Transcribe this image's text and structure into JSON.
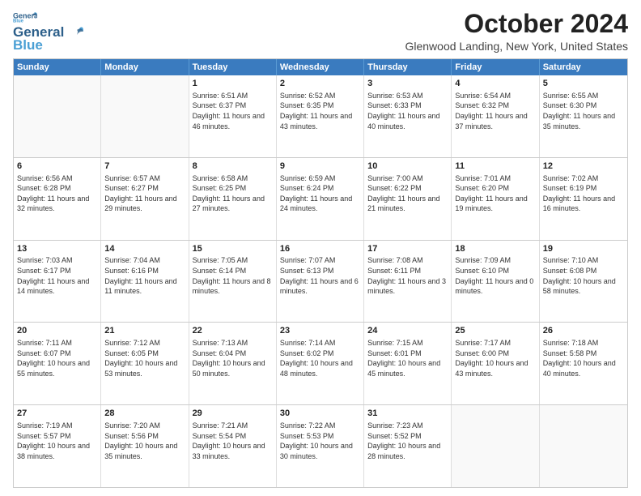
{
  "header": {
    "logo_line1": "General",
    "logo_line2": "Blue",
    "month_title": "October 2024",
    "location": "Glenwood Landing, New York, United States"
  },
  "days_of_week": [
    "Sunday",
    "Monday",
    "Tuesday",
    "Wednesday",
    "Thursday",
    "Friday",
    "Saturday"
  ],
  "weeks": [
    [
      {
        "day": "",
        "text": ""
      },
      {
        "day": "",
        "text": ""
      },
      {
        "day": "1",
        "text": "Sunrise: 6:51 AM\nSunset: 6:37 PM\nDaylight: 11 hours and 46 minutes."
      },
      {
        "day": "2",
        "text": "Sunrise: 6:52 AM\nSunset: 6:35 PM\nDaylight: 11 hours and 43 minutes."
      },
      {
        "day": "3",
        "text": "Sunrise: 6:53 AM\nSunset: 6:33 PM\nDaylight: 11 hours and 40 minutes."
      },
      {
        "day": "4",
        "text": "Sunrise: 6:54 AM\nSunset: 6:32 PM\nDaylight: 11 hours and 37 minutes."
      },
      {
        "day": "5",
        "text": "Sunrise: 6:55 AM\nSunset: 6:30 PM\nDaylight: 11 hours and 35 minutes."
      }
    ],
    [
      {
        "day": "6",
        "text": "Sunrise: 6:56 AM\nSunset: 6:28 PM\nDaylight: 11 hours and 32 minutes."
      },
      {
        "day": "7",
        "text": "Sunrise: 6:57 AM\nSunset: 6:27 PM\nDaylight: 11 hours and 29 minutes."
      },
      {
        "day": "8",
        "text": "Sunrise: 6:58 AM\nSunset: 6:25 PM\nDaylight: 11 hours and 27 minutes."
      },
      {
        "day": "9",
        "text": "Sunrise: 6:59 AM\nSunset: 6:24 PM\nDaylight: 11 hours and 24 minutes."
      },
      {
        "day": "10",
        "text": "Sunrise: 7:00 AM\nSunset: 6:22 PM\nDaylight: 11 hours and 21 minutes."
      },
      {
        "day": "11",
        "text": "Sunrise: 7:01 AM\nSunset: 6:20 PM\nDaylight: 11 hours and 19 minutes."
      },
      {
        "day": "12",
        "text": "Sunrise: 7:02 AM\nSunset: 6:19 PM\nDaylight: 11 hours and 16 minutes."
      }
    ],
    [
      {
        "day": "13",
        "text": "Sunrise: 7:03 AM\nSunset: 6:17 PM\nDaylight: 11 hours and 14 minutes."
      },
      {
        "day": "14",
        "text": "Sunrise: 7:04 AM\nSunset: 6:16 PM\nDaylight: 11 hours and 11 minutes."
      },
      {
        "day": "15",
        "text": "Sunrise: 7:05 AM\nSunset: 6:14 PM\nDaylight: 11 hours and 8 minutes."
      },
      {
        "day": "16",
        "text": "Sunrise: 7:07 AM\nSunset: 6:13 PM\nDaylight: 11 hours and 6 minutes."
      },
      {
        "day": "17",
        "text": "Sunrise: 7:08 AM\nSunset: 6:11 PM\nDaylight: 11 hours and 3 minutes."
      },
      {
        "day": "18",
        "text": "Sunrise: 7:09 AM\nSunset: 6:10 PM\nDaylight: 11 hours and 0 minutes."
      },
      {
        "day": "19",
        "text": "Sunrise: 7:10 AM\nSunset: 6:08 PM\nDaylight: 10 hours and 58 minutes."
      }
    ],
    [
      {
        "day": "20",
        "text": "Sunrise: 7:11 AM\nSunset: 6:07 PM\nDaylight: 10 hours and 55 minutes."
      },
      {
        "day": "21",
        "text": "Sunrise: 7:12 AM\nSunset: 6:05 PM\nDaylight: 10 hours and 53 minutes."
      },
      {
        "day": "22",
        "text": "Sunrise: 7:13 AM\nSunset: 6:04 PM\nDaylight: 10 hours and 50 minutes."
      },
      {
        "day": "23",
        "text": "Sunrise: 7:14 AM\nSunset: 6:02 PM\nDaylight: 10 hours and 48 minutes."
      },
      {
        "day": "24",
        "text": "Sunrise: 7:15 AM\nSunset: 6:01 PM\nDaylight: 10 hours and 45 minutes."
      },
      {
        "day": "25",
        "text": "Sunrise: 7:17 AM\nSunset: 6:00 PM\nDaylight: 10 hours and 43 minutes."
      },
      {
        "day": "26",
        "text": "Sunrise: 7:18 AM\nSunset: 5:58 PM\nDaylight: 10 hours and 40 minutes."
      }
    ],
    [
      {
        "day": "27",
        "text": "Sunrise: 7:19 AM\nSunset: 5:57 PM\nDaylight: 10 hours and 38 minutes."
      },
      {
        "day": "28",
        "text": "Sunrise: 7:20 AM\nSunset: 5:56 PM\nDaylight: 10 hours and 35 minutes."
      },
      {
        "day": "29",
        "text": "Sunrise: 7:21 AM\nSunset: 5:54 PM\nDaylight: 10 hours and 33 minutes."
      },
      {
        "day": "30",
        "text": "Sunrise: 7:22 AM\nSunset: 5:53 PM\nDaylight: 10 hours and 30 minutes."
      },
      {
        "day": "31",
        "text": "Sunrise: 7:23 AM\nSunset: 5:52 PM\nDaylight: 10 hours and 28 minutes."
      },
      {
        "day": "",
        "text": ""
      },
      {
        "day": "",
        "text": ""
      }
    ]
  ]
}
